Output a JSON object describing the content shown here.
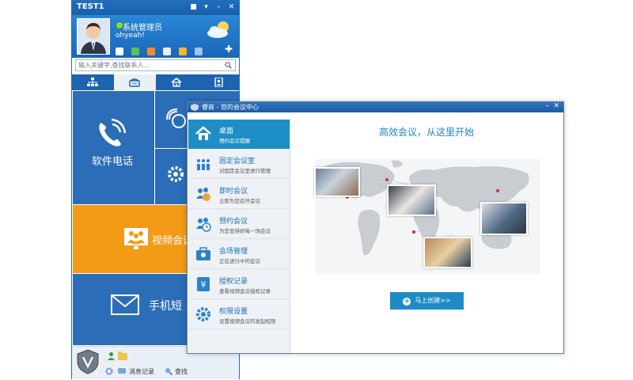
{
  "client": {
    "title": "TEST1",
    "user_name": "系统管理员",
    "status": "ohyeah!",
    "search_placeholder": "输入关键字,查找联系人...",
    "tabs": [
      {
        "icon": "org-chart-icon"
      },
      {
        "icon": "phone-icon"
      },
      {
        "icon": "home-icon"
      },
      {
        "icon": "contacts-icon"
      }
    ],
    "tiles": {
      "phone_label": "软件电话",
      "video_label": "视频会议",
      "sms_label": "手机短"
    },
    "bottom": {
      "messages_label": "消息记录",
      "find_label": "查找"
    }
  },
  "meeting_center": {
    "window_title": "睿商 - 您的会议中心",
    "headline": "高效会议，从这里开始",
    "create_button": "马上创建>>",
    "menu": [
      {
        "title": "桌面",
        "subtitle": "预约会议提醒",
        "icon": "home-icon"
      },
      {
        "title": "固定会议室",
        "subtitle": "对固定会议室进行管理",
        "icon": "fixed-room-icon"
      },
      {
        "title": "即时会议",
        "subtitle": "立即为您召开会议",
        "icon": "instant-meeting-icon"
      },
      {
        "title": "预约会议",
        "subtitle": "为您安排好每一场会议",
        "icon": "scheduled-meeting-icon"
      },
      {
        "title": "会场管理",
        "subtitle": "正在进行中的会议",
        "icon": "venue-icon"
      },
      {
        "title": "授权记录",
        "subtitle": "查看视频会议授权记录",
        "icon": "yen-icon"
      },
      {
        "title": "权限设置",
        "subtitle": "设置视频会议的发起权限",
        "icon": "gear-icon"
      }
    ]
  },
  "colors": {
    "brand_blue": "#2c6db7",
    "video_orange": "#f39a17",
    "accent": "#1e8fc6"
  }
}
